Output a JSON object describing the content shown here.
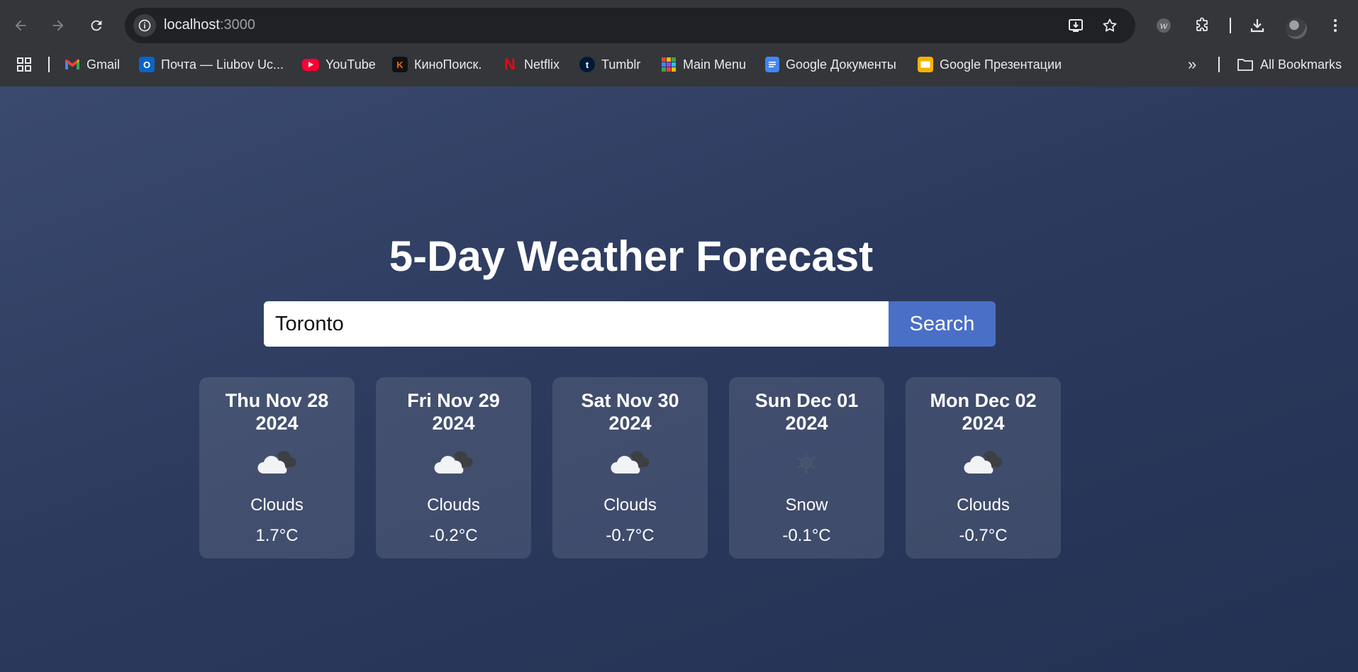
{
  "browser": {
    "url_host": "localhost",
    "url_port": ":3000",
    "bookmarks": [
      {
        "label": "Gmail",
        "icon": "gmail-icon"
      },
      {
        "label": "Почта — Liubov Uc...",
        "icon": "outlook-icon"
      },
      {
        "label": "YouTube",
        "icon": "youtube-icon"
      },
      {
        "label": "КиноПоиск.",
        "icon": "kinopoisk-icon"
      },
      {
        "label": "Netflix",
        "icon": "netflix-icon"
      },
      {
        "label": "Tumblr",
        "icon": "tumblr-icon"
      },
      {
        "label": "Main Menu",
        "icon": "grid-colorful-icon"
      },
      {
        "label": "Google Документы",
        "icon": "google-docs-icon"
      },
      {
        "label": "Google Презентации",
        "icon": "google-slides-icon"
      }
    ],
    "all_bookmarks_label": "All Bookmarks"
  },
  "page": {
    "title": "5-Day Weather Forecast",
    "search": {
      "value": "Toronto",
      "button_label": "Search"
    },
    "forecast": [
      {
        "date_line1": "Thu Nov 28",
        "date_line2": "2024",
        "icon": "clouds-icon",
        "desc": "Clouds",
        "temp": "1.7°C"
      },
      {
        "date_line1": "Fri Nov 29",
        "date_line2": "2024",
        "icon": "clouds-icon",
        "desc": "Clouds",
        "temp": "-0.2°C"
      },
      {
        "date_line1": "Sat Nov 30",
        "date_line2": "2024",
        "icon": "clouds-icon",
        "desc": "Clouds",
        "temp": "-0.7°C"
      },
      {
        "date_line1": "Sun Dec 01",
        "date_line2": "2024",
        "icon": "snow-icon",
        "desc": "Snow",
        "temp": "-0.1°C"
      },
      {
        "date_line1": "Mon Dec 02",
        "date_line2": "2024",
        "icon": "clouds-icon",
        "desc": "Clouds",
        "temp": "-0.7°C"
      }
    ]
  },
  "colors": {
    "page_bg": "#2c3a5e",
    "button": "#4a6fc6",
    "card_bg": "rgba(255,255,255,0.11)",
    "chrome_bg": "#35363a"
  }
}
